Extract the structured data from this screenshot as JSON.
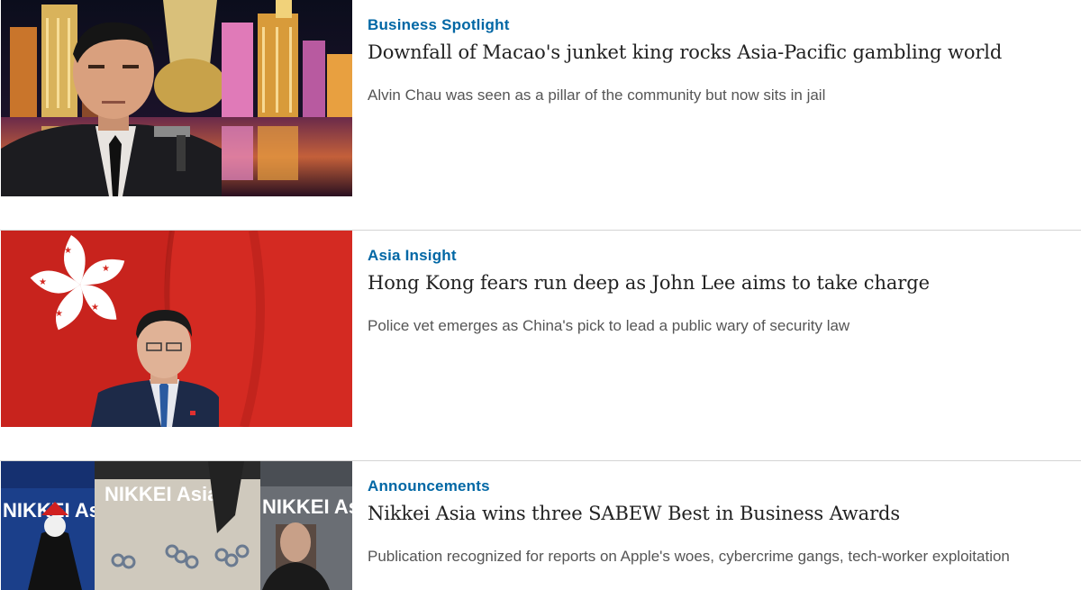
{
  "articles": [
    {
      "section": "Business Spotlight",
      "headline": "Downfall of Macao's junket king rocks Asia-Pacific gambling world",
      "summary": "Alvin Chau was seen as a pillar of the community but now sits in jail",
      "image_icon": "photo-man-casino-skyline"
    },
    {
      "section": "Asia Insight",
      "headline": "Hong Kong fears run deep as John Lee aims to take charge",
      "summary": "Police vet emerges as China's pick to lead a public wary of security law",
      "image_icon": "photo-man-hong-kong-flag"
    },
    {
      "section": "Announcements",
      "headline": "Nikkei Asia wins three SABEW Best in Business Awards",
      "summary": "Publication recognized for reports on Apple's woes, cybercrime gangs, tech-worker exploitation",
      "image_icon": "photo-magazine-covers",
      "covers": [
        "NIKKEI Asia",
        "NIKKEI Asia",
        "NIKKEI Asia"
      ]
    }
  ],
  "colors": {
    "section": "#0067a5",
    "headline": "#222222",
    "summary": "#555555",
    "divider": "#d4d4d4"
  }
}
